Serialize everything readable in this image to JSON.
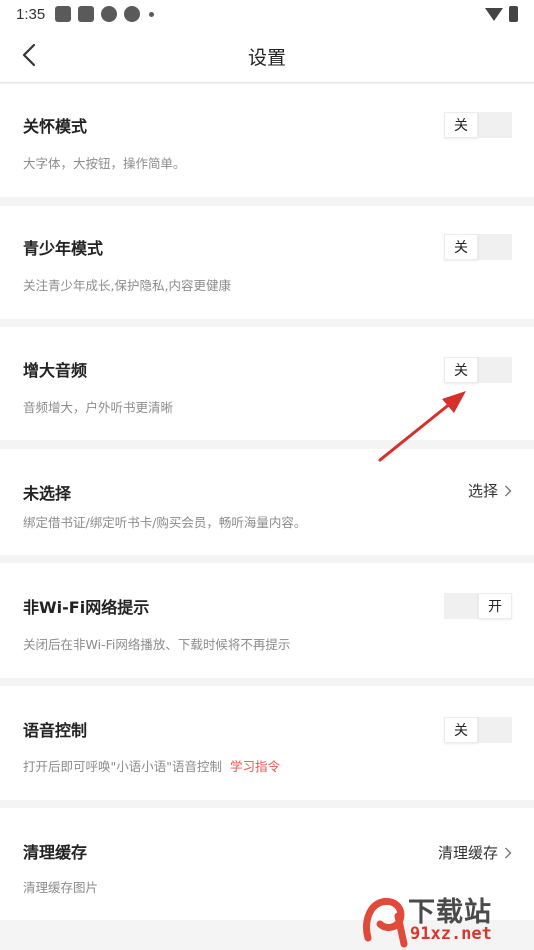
{
  "status_bar": {
    "time": "1:35"
  },
  "header": {
    "title": "设置"
  },
  "settings": [
    {
      "title": "关怀模式",
      "desc": "大字体，大按钮，操作简单。",
      "control": "toggle",
      "state": "关",
      "on": false
    },
    {
      "title": "青少年模式",
      "desc": "关注青少年成长,保护隐私,内容更健康",
      "control": "toggle",
      "state": "关",
      "on": false
    },
    {
      "title": "增大音频",
      "desc": "音频增大，户外听书更清晰",
      "control": "toggle",
      "state": "关",
      "on": false
    },
    {
      "title": "未选择",
      "desc": "绑定借书证/绑定听书卡/购买会员，畅听海量内容。",
      "control": "link",
      "action": "选择"
    },
    {
      "title": "非Wi-Fi网络提示",
      "desc": "关闭后在非Wi-Fi网络播放、下载时候将不再提示",
      "control": "toggle",
      "state": "开",
      "on": true
    },
    {
      "title": "语音控制",
      "desc": "打开后即可呼唤\"小语小语\"语音控制",
      "link": "学习指令",
      "control": "toggle",
      "state": "关",
      "on": false
    },
    {
      "title": "清理缓存",
      "desc": "清理缓存图片",
      "control": "link",
      "action": "清理缓存"
    }
  ],
  "watermark": {
    "brand": "下载站",
    "url": "91xz.net"
  },
  "colors": {
    "accent_link": "#e8584a",
    "annotation_arrow": "#d6302a",
    "background": "#f4f4f4"
  }
}
